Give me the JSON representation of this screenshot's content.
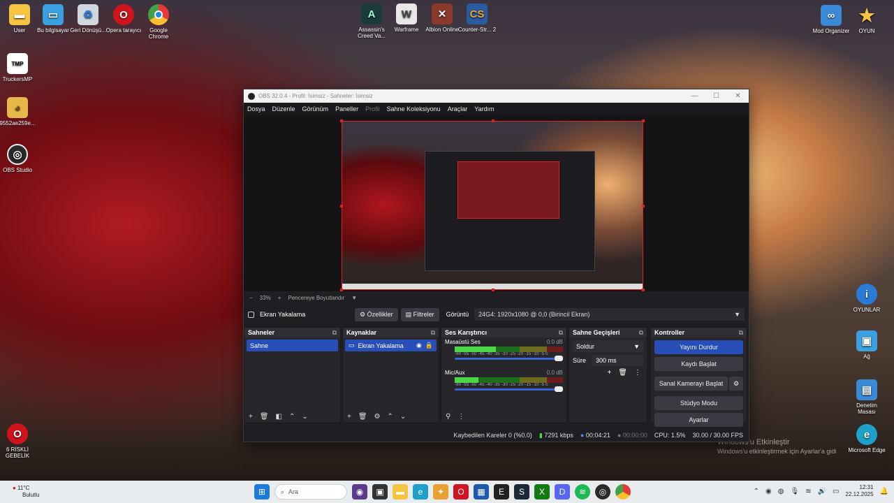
{
  "desktop": {
    "left_icons": [
      {
        "label": "User",
        "icon": "folder-icon",
        "color": "#f5c542"
      },
      {
        "label": "Bu bilgisayar",
        "icon": "computer-icon",
        "color": "#3aa0e0"
      },
      {
        "label": "Geri Dönüşü...",
        "icon": "recycle-bin-icon",
        "color": "#cfd8dc"
      },
      {
        "label": "Opera tarayıcı",
        "icon": "opera-icon",
        "color": "#d0141e"
      },
      {
        "label": "Google Chrome",
        "icon": "chrome-icon",
        "color": "#2f9e44"
      },
      {
        "label": "TruckersMP",
        "icon": "truckersmp-icon",
        "color": "#ffffff"
      },
      {
        "label": "9552ae259e...",
        "icon": "duck-image-icon",
        "color": "#e6b74a"
      },
      {
        "label": "OBS Studio",
        "icon": "obs-icon",
        "color": "#2a2a2a"
      },
      {
        "label": "6 RİSKLİ GEBELİK",
        "icon": "opera-icon",
        "color": "#d0141e"
      }
    ],
    "top_icons": [
      {
        "label": "Assassin's Creed Va...",
        "icon": "assassins-creed-icon",
        "color": "#1b3a3a"
      },
      {
        "label": "Warframe",
        "icon": "warframe-icon",
        "color": "#e8e8e8"
      },
      {
        "label": "Albion Online",
        "icon": "albion-icon",
        "color": "#8a3a2a"
      },
      {
        "label": "Counter-Str... 2",
        "icon": "cs2-icon",
        "color": "#2a5aa0"
      }
    ],
    "right_icons": [
      {
        "label": "Mod Organizer",
        "icon": "mod-organizer-icon",
        "color": "#3a8ad8"
      },
      {
        "label": "OYUN",
        "icon": "star-icon",
        "color": "#f5c542"
      },
      {
        "label": "OYUNLAR",
        "icon": "info-icon",
        "color": "#2a7ad8"
      },
      {
        "label": "Ağ",
        "icon": "network-icon",
        "color": "#3aa0e0"
      },
      {
        "label": "Denetim Masası",
        "icon": "control-panel-icon",
        "color": "#3a8ad8"
      },
      {
        "label": "Microsoft Edge",
        "icon": "edge-icon",
        "color": "#1ea0c8"
      }
    ],
    "watermark": {
      "line1": "Windows'u Etkinleştir",
      "line2": "Windows'u etkinleştirmek için Ayarlar'a gidi"
    }
  },
  "obs": {
    "title": "OBS 32.0.4 - Profil: İsimsiz - Sahneler: İsimsiz",
    "window_buttons": [
      "—",
      "☐",
      "✕"
    ],
    "menu": [
      {
        "label": "Dosya",
        "enabled": true
      },
      {
        "label": "Düzenle",
        "enabled": true
      },
      {
        "label": "Görünüm",
        "enabled": true
      },
      {
        "label": "Paneller",
        "enabled": true
      },
      {
        "label": "Profil",
        "enabled": false
      },
      {
        "label": "Sahne Koleksiyonu",
        "enabled": true
      },
      {
        "label": "Araçlar",
        "enabled": true
      },
      {
        "label": "Yardım",
        "enabled": true
      }
    ],
    "zoom": {
      "minus": "−",
      "value": "33%",
      "plus": "+",
      "fit_label": "Pencereye Boyutlandır",
      "fit_caret": "▼"
    },
    "source_bar": {
      "source_name": "Ekran Yakalama",
      "properties_label": "Özellikler",
      "filters_label": "Filtreler",
      "display_label": "Görüntü",
      "display_value": "24G4: 1920x1080 @ 0,0 (Birincil Ekran)",
      "caret": "▼"
    },
    "scenes": {
      "title": "Sahneler",
      "items": [
        "Sahne"
      ]
    },
    "sources": {
      "title": "Kaynaklar",
      "items": [
        "Ekran Yakalama"
      ]
    },
    "mixer": {
      "title": "Ses Karıştırıcı",
      "channels": [
        {
          "name": "Masaüstü Ses",
          "db": "0.0 dB",
          "level": 0.38
        },
        {
          "name": "Mic/Aux",
          "db": "0.0 dB",
          "level": 0.22
        }
      ],
      "ticks": "-60 -55 -50 -45 -40 -35 -30 -25 -20 -15 -10 -5 0"
    },
    "transitions": {
      "title": "Sahne Geçişleri",
      "type": "Soldur",
      "duration_label": "Süre",
      "duration_value": "300 ms"
    },
    "controls": {
      "title": "Kontroller",
      "buttons": [
        "Yayını Durdur",
        "Kaydı Başlat",
        "Sanal Kamerayı Başlat",
        "Stüdyo Modu",
        "Ayarlar"
      ]
    },
    "status": {
      "dropped": "Kaybedilen Kareler 0 (%0.0)",
      "bitrate": "7291 kbps",
      "stream_time": "00:04:21",
      "rec_time": "00:00:00",
      "cpu": "CPU: 1.5%",
      "fps": "30.00 / 30.00 FPS"
    }
  },
  "taskbar": {
    "weather": {
      "temp": "11°C",
      "desc": "Bulutlu"
    },
    "search_placeholder": "Ara",
    "clock": {
      "time": "12:31",
      "date": "22.12.2025"
    }
  }
}
